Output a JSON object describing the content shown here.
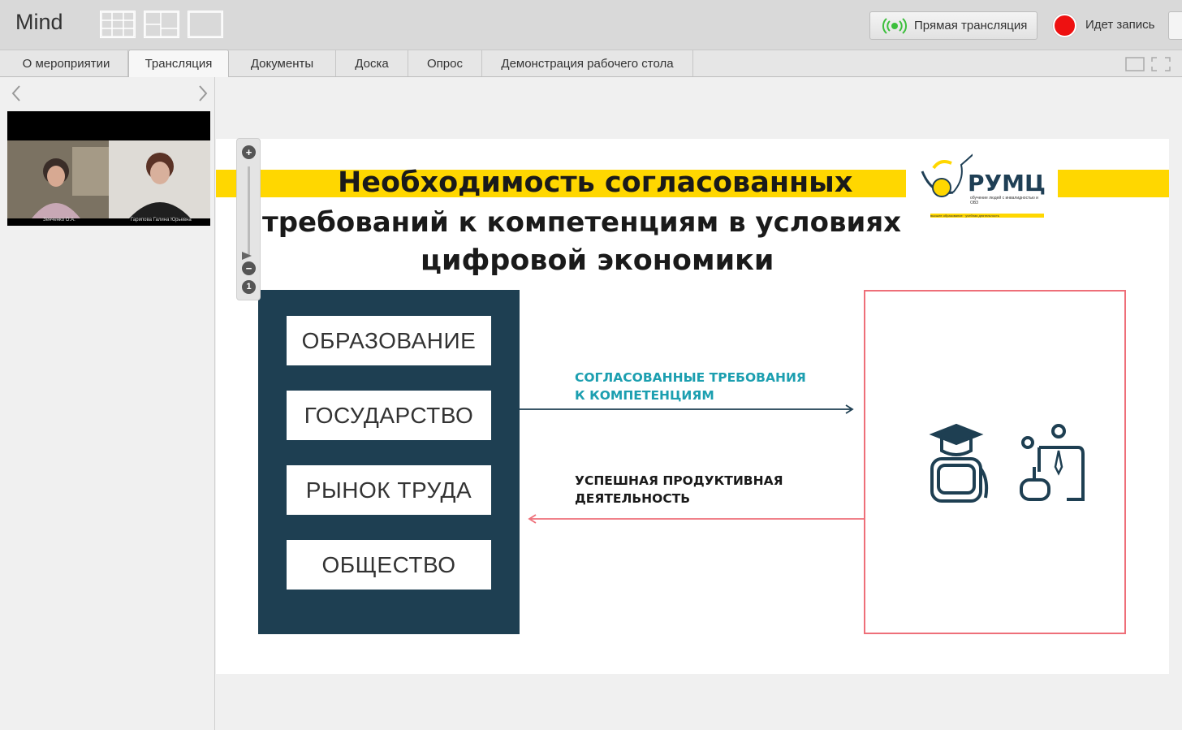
{
  "app": {
    "title": "Mind"
  },
  "header": {
    "live_label": "Прямая трансляция",
    "recording_label": "Идет запись"
  },
  "tabs": [
    {
      "label": "О мероприятии"
    },
    {
      "label": "Трансляция",
      "active": true
    },
    {
      "label": "Документы"
    },
    {
      "label": "Доска"
    },
    {
      "label": "Опрос"
    },
    {
      "label": "Демонстрация рабочего стола"
    }
  ],
  "video": {
    "caption_left": "Зенченко О.А.",
    "caption_right": "Гарипова Галина Юрьевна"
  },
  "slide": {
    "title_line1": "Необходимость согласованных",
    "title_line2": "требований к компетенциям в условиях",
    "title_line3": "цифровой экономики",
    "logo": "РУМЦ",
    "logo_sub": "обучение людей с инвалидностью и ОВЗ",
    "logo_sub2": "высшее образование · учебная деятельность",
    "boxes": [
      "ОБРАЗОВАНИЕ",
      "ГОСУДАРСТВО",
      "РЫНОК ТРУДА",
      "ОБЩЕСТВО"
    ],
    "arrow_top_line1": "СОГЛАСОВАННЫЕ ТРЕБОВАНИЯ",
    "arrow_top_line2": "К КОМПЕТЕНЦИЯМ",
    "arrow_bottom_line1": "УСПЕШНАЯ ПРОДУКТИВНАЯ",
    "arrow_bottom_line2": "ДЕЯТЕЛЬНОСТЬ"
  },
  "colors": {
    "accent_yellow": "#ffd700",
    "panel_dark": "#1e3f52",
    "teal": "#1c9fb0",
    "pink": "#ee6f79",
    "record_red": "#ee1111",
    "live_green": "#3cbf3c"
  },
  "icons": [
    "grid-layout-icon",
    "split-layout-icon",
    "single-layout-icon",
    "broadcast-icon",
    "record-icon",
    "window-icon",
    "fullscreen-icon",
    "chevron-left-icon",
    "chevron-right-icon",
    "zoom-in-icon",
    "zoom-out-icon",
    "zoom-reset-icon",
    "graduate-icon",
    "employee-icon"
  ]
}
